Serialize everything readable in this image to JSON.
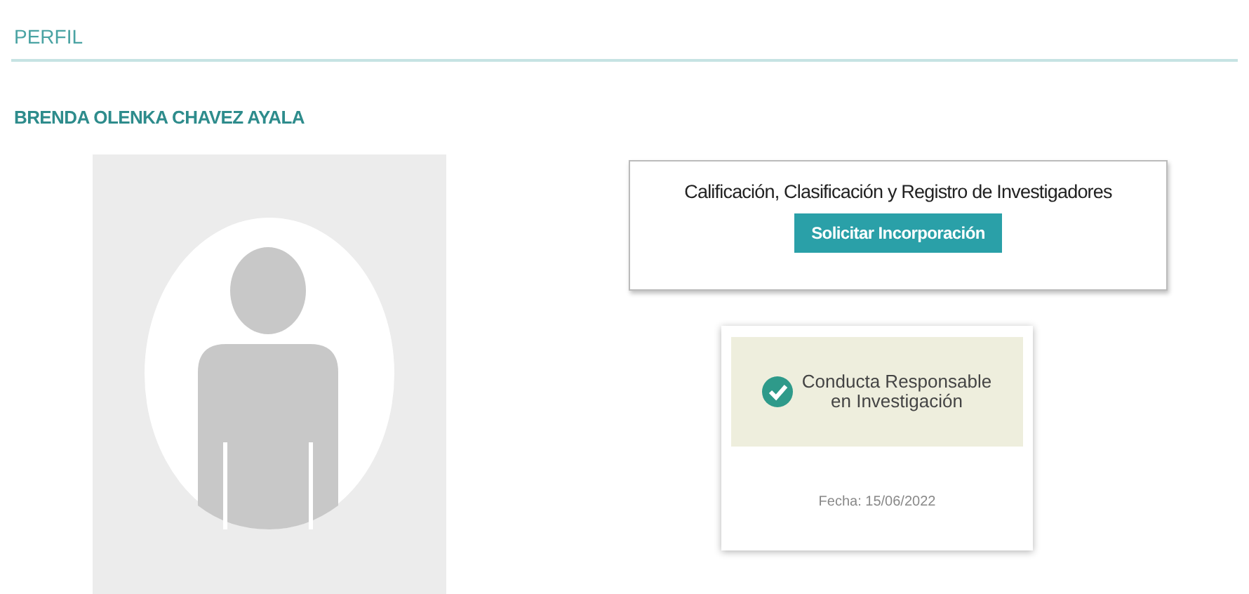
{
  "header": {
    "title": "PERFIL"
  },
  "profile": {
    "name": "BRENDA OLENKA CHAVEZ AYALA",
    "avatar": {
      "kind": "placeholder"
    }
  },
  "registry_card": {
    "title": "Calificación, Clasificación y Registro de Investigadores",
    "button": "Solicitar Incorporación"
  },
  "badge_card": {
    "verified": true,
    "title_lines": [
      "Conducta Responsable",
      "en Investigación"
    ],
    "date": "Fecha: 15/06/2022"
  }
}
